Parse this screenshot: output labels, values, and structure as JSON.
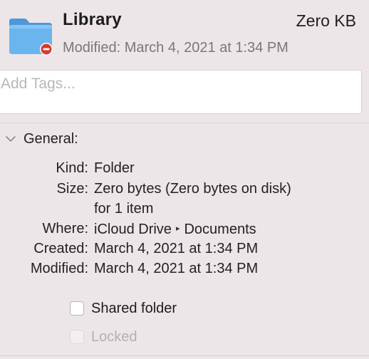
{
  "header": {
    "title": "Library",
    "size": "Zero KB",
    "modified": "Modified: March 4, 2021 at 1:34 PM",
    "icon": "folder-icon",
    "badge_icon": "no-entry-badge-icon",
    "folder_color": "#5aa9e6",
    "badge_color": "#d93a2b"
  },
  "tags": {
    "placeholder": "Add Tags...",
    "value": ""
  },
  "general": {
    "label": "General:",
    "kind": {
      "key": "Kind:",
      "value": "Folder"
    },
    "size": {
      "key": "Size:",
      "value": "Zero bytes (Zero bytes on disk)",
      "value_line2": "for 1 item"
    },
    "where": {
      "key": "Where:",
      "part1": "iCloud Drive",
      "separator": "▸",
      "part2": "Documents"
    },
    "created": {
      "key": "Created:",
      "value": "March 4, 2021 at 1:34 PM"
    },
    "modified": {
      "key": "Modified:",
      "value": "March 4, 2021 at 1:34 PM"
    }
  },
  "options": {
    "shared_folder": {
      "label": "Shared folder",
      "checked": false,
      "enabled": true
    },
    "locked": {
      "label": "Locked",
      "checked": false,
      "enabled": false
    }
  }
}
